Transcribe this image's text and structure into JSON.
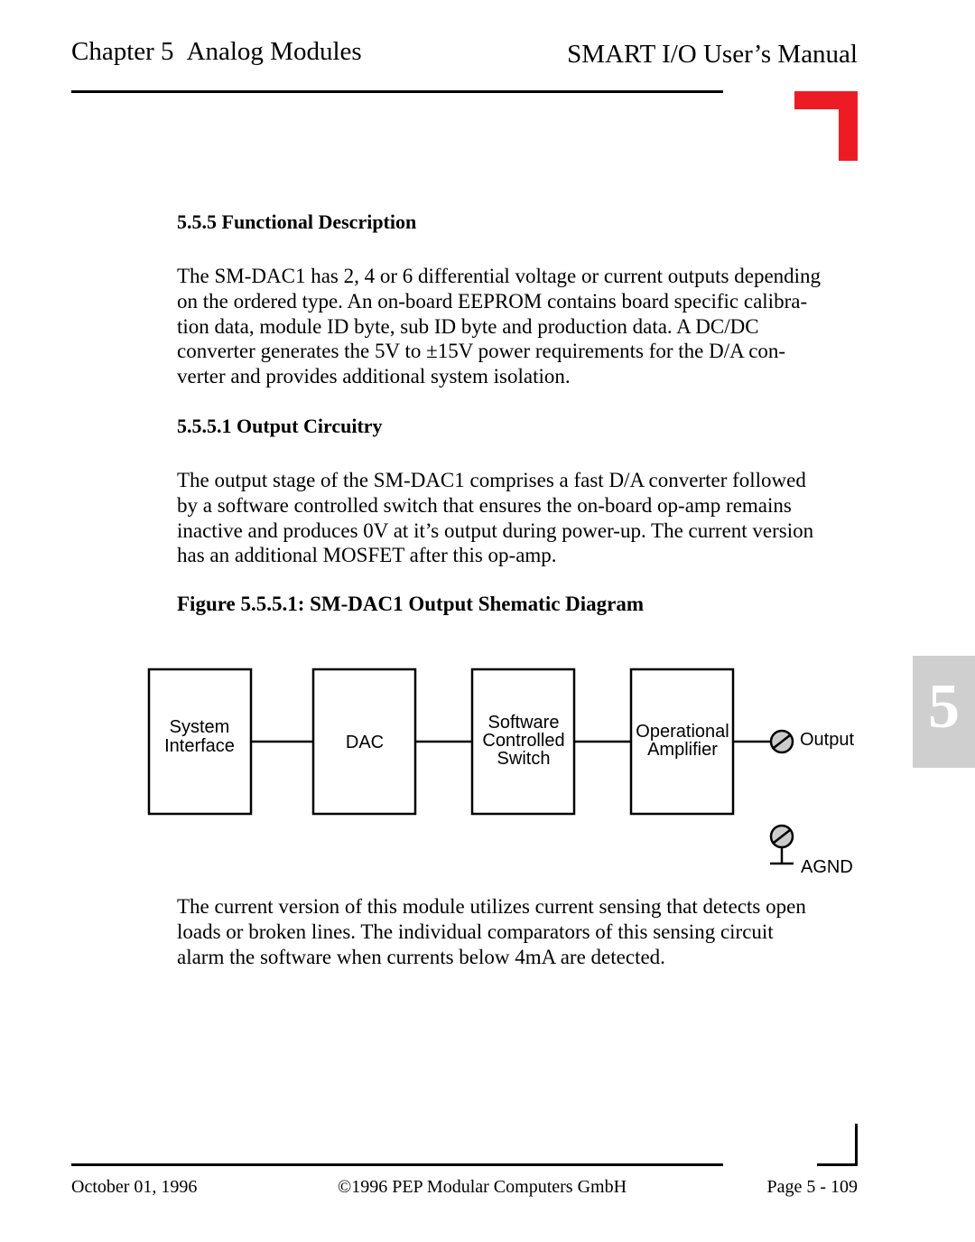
{
  "header": {
    "chapter_label": "Chapter 5",
    "chapter_title": "Analog Modules",
    "manual_title": "SMART I/O User’s Manual"
  },
  "sections": {
    "functional_description": {
      "heading": "5.5.5 Functional Description",
      "lines": [
        "The SM-DAC1 has 2, 4 or 6 differential voltage or current outputs depending",
        "on the ordered type. An on-board EEPROM contains board specific calibra-",
        "tion data, module ID byte, sub ID byte and production data. A DC/DC",
        "converter generates the 5V to ±15V power requirements for the D/A con-",
        "verter and provides additional system isolation."
      ]
    },
    "output_circuitry": {
      "heading": "5.5.5.1 Output Circuitry",
      "lines": [
        "The output stage of the SM-DAC1 comprises a fast D/A converter followed",
        "by a software controlled switch that ensures the on-board op-amp remains",
        "inactive and produces 0V at it’s output during power-up. The current version",
        "has an additional MOSFET after this op-amp."
      ]
    },
    "figure": {
      "caption": "Figure 5.5.5.1: SM-DAC1 Output Shematic Diagram",
      "blocks": [
        {
          "lines": [
            "System",
            "Interface"
          ]
        },
        {
          "lines": [
            "DAC"
          ]
        },
        {
          "lines": [
            "Software",
            "Controlled",
            "Switch"
          ]
        },
        {
          "lines": [
            "Operational",
            "Amplifier"
          ]
        }
      ],
      "output_label": "Output",
      "ground_label": "AGND"
    },
    "current_sensing": {
      "lines": [
        "The current version of this module utilizes current sensing that detects open",
        "loads or broken lines. The individual comparators of this sensing circuit",
        "alarm the software when currents below 4mA are detected."
      ]
    }
  },
  "chapter_tab": {
    "number": "5"
  },
  "footer": {
    "date": "October 01, 1996",
    "copyright": "©1996 PEP Modular Computers GmbH",
    "page": "Page 5 - 109"
  },
  "colors": {
    "accent_red": "#ed1c24",
    "tab_gray": "#cfcfcf",
    "terminal_fill": "#cccccc"
  }
}
